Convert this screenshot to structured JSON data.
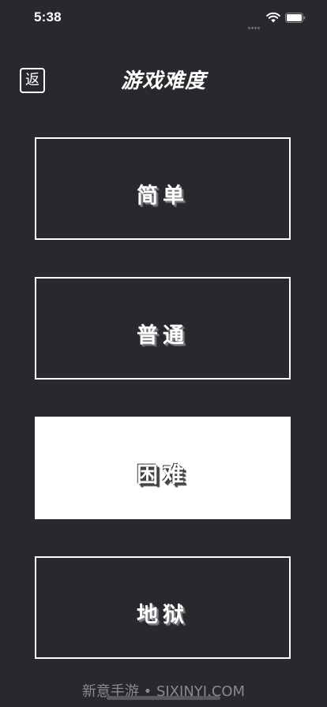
{
  "status_bar": {
    "time": "5:38"
  },
  "header": {
    "back_label": "返",
    "title": "游戏难度"
  },
  "options": [
    {
      "label": "简单",
      "selected": false
    },
    {
      "label": "普通",
      "selected": false
    },
    {
      "label": "困难",
      "selected": true
    },
    {
      "label": "地狱",
      "selected": false
    }
  ],
  "watermark": "新意手游 • SJXINYI.COM",
  "colors": {
    "background": "#29282d",
    "foreground": "#ffffff",
    "watermark": "#8a8a8d"
  },
  "icons": [
    "wifi-icon",
    "battery-icon",
    "signal-dots-icon"
  ]
}
